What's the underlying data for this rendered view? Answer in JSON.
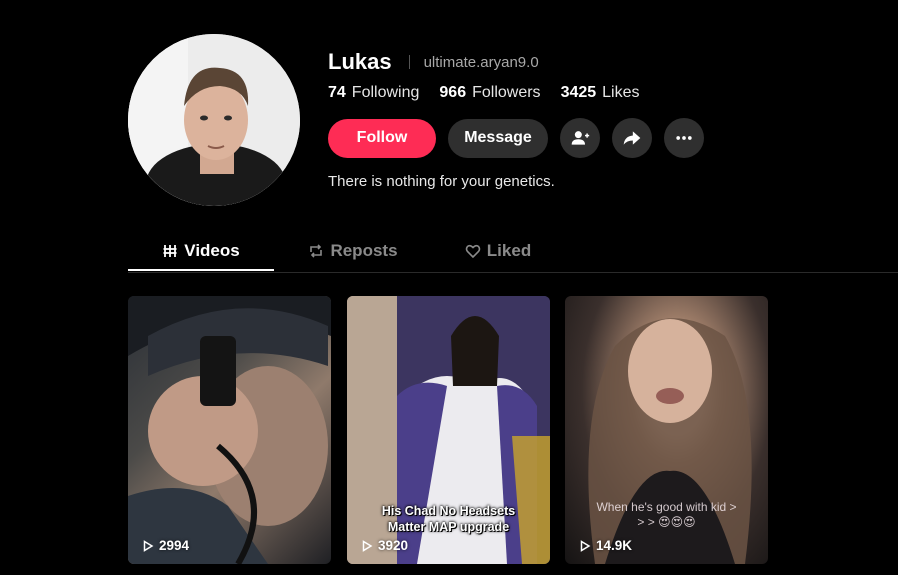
{
  "profile": {
    "display_name": "Lukas",
    "handle": "ultimate.aryan9.0",
    "bio": "There is nothing for your genetics."
  },
  "stats": [
    {
      "value": "74",
      "label": "Following"
    },
    {
      "value": "966",
      "label": "Followers"
    },
    {
      "value": "3425",
      "label": "Likes"
    }
  ],
  "actions": {
    "follow_label": "Follow",
    "message_label": "Message",
    "icons": [
      "add-friend-icon",
      "share-icon",
      "more-icon"
    ]
  },
  "tabs": [
    {
      "label": "Videos",
      "icon": "grid-icon",
      "active": true
    },
    {
      "label": "Reposts",
      "icon": "repost-icon",
      "active": false
    },
    {
      "label": "Liked",
      "icon": "heart-icon",
      "active": false
    }
  ],
  "videos": [
    {
      "views": "2994",
      "caption": ""
    },
    {
      "views": "3920",
      "caption": "His Chad No Headsets Matter MAP upgrade"
    },
    {
      "views": "14.9K",
      "caption": "When he's good with kid > > > 😍😍😍"
    }
  ],
  "colors": {
    "accent": "#fe2c55",
    "background": "#000000",
    "button_bg": "#2f2f2f"
  }
}
